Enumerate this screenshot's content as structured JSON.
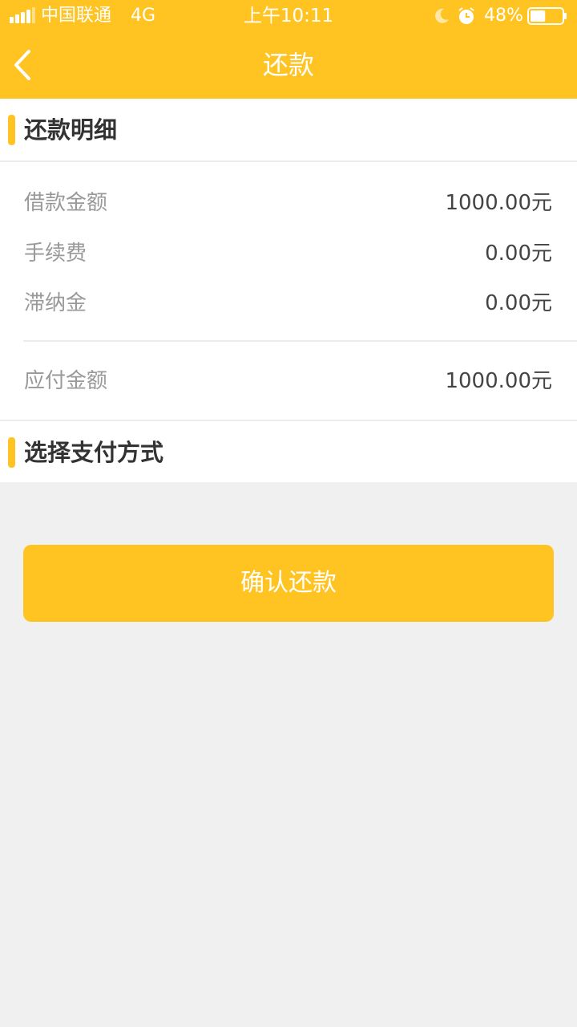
{
  "status_bar": {
    "carrier": "中国联通",
    "network": "4G",
    "time": "上午10:11",
    "battery_percent": "48%",
    "battery_level": 0.48,
    "icons": [
      "signal-icon",
      "moon-icon",
      "alarm-icon",
      "battery-icon"
    ]
  },
  "nav": {
    "title": "还款",
    "back_icon": "chevron-left-icon"
  },
  "repayment_detail": {
    "section_title": "还款明细",
    "rows": [
      {
        "label": "借款金额",
        "value": "1000.00元"
      },
      {
        "label": "手续费",
        "value": "0.00元"
      },
      {
        "label": "滞纳金",
        "value": "0.00元"
      }
    ],
    "total": {
      "label": "应付金额",
      "value": "1000.00元"
    }
  },
  "payment_method": {
    "section_title": "选择支付方式"
  },
  "confirm_button": {
    "label": "确认还款"
  },
  "colors": {
    "accent": "#ffc322",
    "background": "#f0f0f0",
    "card": "#ffffff",
    "label_text": "#999999",
    "value_text": "#444444",
    "title_text": "#333333"
  }
}
